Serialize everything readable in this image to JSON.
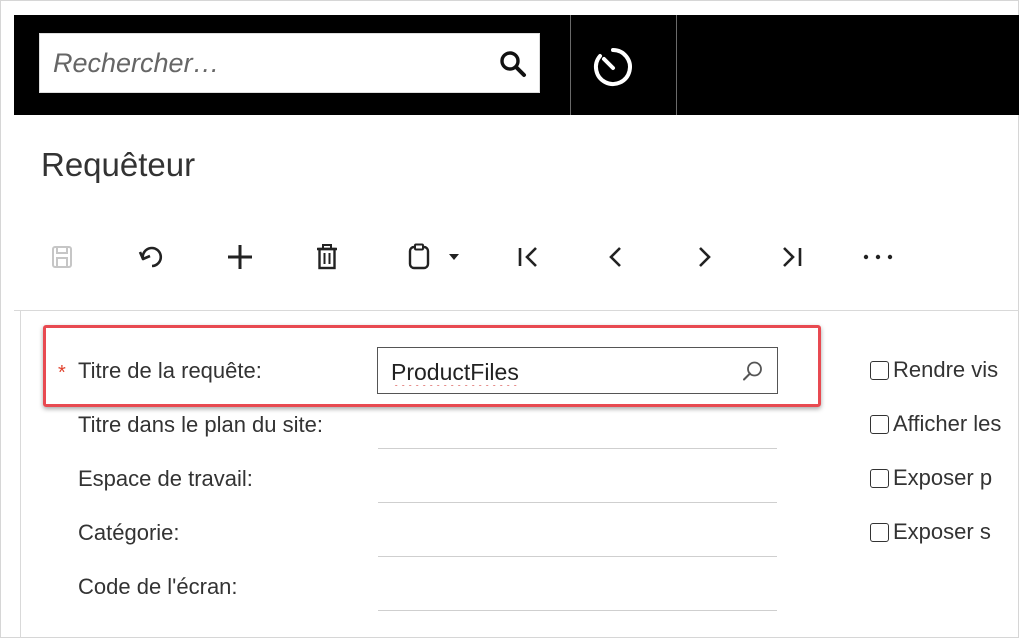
{
  "search": {
    "placeholder": "Rechercher…"
  },
  "icons": {
    "search": "search-icon",
    "timer": "timer-icon",
    "save": "save-icon",
    "undo": "undo-icon",
    "add": "plus-icon",
    "delete": "trash-icon",
    "copy_paste": "clipboard-icon",
    "first": "first-record-icon",
    "previous": "chevron-left-icon",
    "next": "chevron-right-icon",
    "last": "last-record-icon",
    "more": "more-icon"
  },
  "page": {
    "title": "Requêteur"
  },
  "form": {
    "required_marker": "*",
    "fields": [
      {
        "label": "Titre de la requête:",
        "value": "ProductFiles",
        "required": true
      },
      {
        "label": "Titre dans le plan du site:",
        "value": ""
      },
      {
        "label": "Espace de travail:",
        "value": ""
      },
      {
        "label": "Catégorie:",
        "value": ""
      },
      {
        "label": "Code de l'écran:",
        "value": ""
      }
    ],
    "checkboxes": [
      {
        "label": "Rendre vis",
        "checked": false
      },
      {
        "label": "Afficher les",
        "checked": false
      },
      {
        "label": "Exposer p",
        "checked": false
      },
      {
        "label": "Exposer s",
        "checked": false
      }
    ]
  },
  "colors": {
    "topbar": "#000000",
    "highlight": "#e84a51",
    "required": "#e0412c",
    "text": "#333333"
  }
}
